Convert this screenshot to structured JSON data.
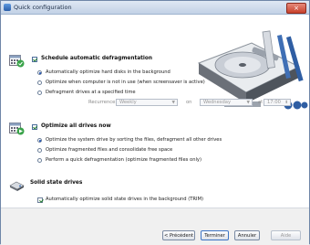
{
  "window": {
    "title": "Quick configuration",
    "close_label": "×"
  },
  "sections": {
    "schedule": {
      "title": "Schedule automatic defragmentation",
      "options": [
        "Automatically optimize hard disks in the background",
        "Optimize when computer is not in use (when screensaver is active)",
        "Defragment drives at a specified time"
      ],
      "recurrence_label": "Recurrence:",
      "recurrence_value": "Weekly",
      "on_label": "on",
      "day_value": "Wednesday",
      "at_label": "at",
      "time_value": "17:00"
    },
    "optimize": {
      "title": "Optimize all drives now",
      "options": [
        "Optimize the system drive by sorting the files, defragment all other drives",
        "Optimize fragmented files and consolidate free space",
        "Perform a quick defragmentation (optimize fragmented files only)"
      ]
    },
    "ssd": {
      "title": "Solid state drives",
      "option": "Automatically optimize solid state drives in the background (TRIM)"
    }
  },
  "buttons": {
    "previous": "< Précédent",
    "finish": "Terminer",
    "cancel": "Annuler",
    "help": "Aide"
  }
}
